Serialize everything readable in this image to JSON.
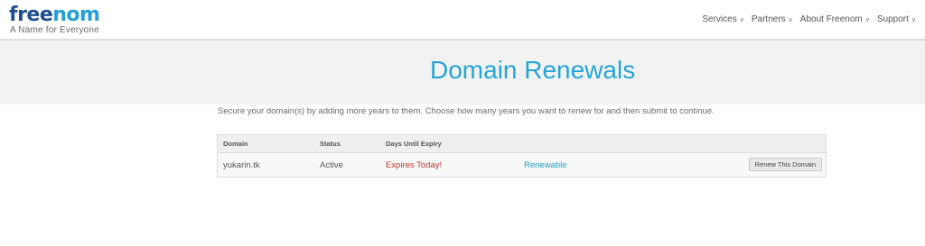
{
  "header": {
    "logo_part1": "free",
    "logo_part2": "nom",
    "tagline": "A Name for Everyone",
    "nav": [
      {
        "label": "Services",
        "icon": "chevron-down-icon"
      },
      {
        "label": "Partners",
        "icon": "chevron-down-icon"
      },
      {
        "label": "About Freenom",
        "icon": "chevron-down-icon"
      },
      {
        "label": "Support",
        "icon": "chevron-down-icon"
      }
    ]
  },
  "page": {
    "title": "Domain Renewals",
    "intro": "Secure your domain(s) by adding more years to them. Choose how many years you want to renew for and then submit to continue."
  },
  "table": {
    "headers": [
      "Domain",
      "Status",
      "Days Until Expiry"
    ],
    "rows": [
      {
        "domain": "yukarin.tk",
        "status": "Active",
        "expiry": "Expires Today!",
        "renewable": "Renewable",
        "button": "Renew This Domain"
      }
    ]
  },
  "colors": {
    "brand_blue": "#22a6d6",
    "logo_dark": "#1d4f8f",
    "expiry_red": "#c0392b",
    "title_band": "#f2f2f2"
  }
}
